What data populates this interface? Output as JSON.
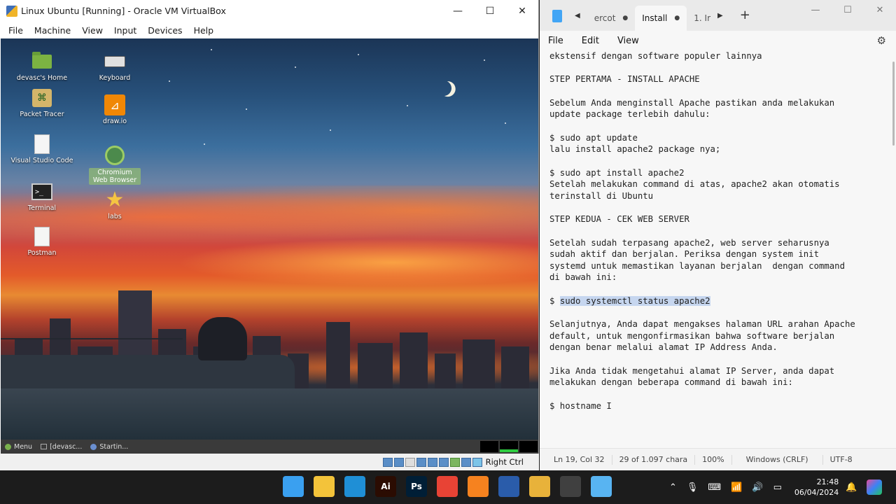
{
  "vbox": {
    "title": "Linux Ubuntu [Running] - Oracle VM VirtualBox",
    "window_controls": [
      "—",
      "☐",
      "✕"
    ],
    "menu": [
      "File",
      "Machine",
      "View",
      "Input",
      "Devices",
      "Help"
    ],
    "desktop_icons": [
      {
        "label": "devasc's Home",
        "icon": "folder-icon"
      },
      {
        "label": "Keyboard",
        "icon": "keyboard-icon"
      },
      {
        "label": "Packet Tracer",
        "icon": "packet-tracer-icon"
      },
      {
        "label": "draw.io",
        "icon": "drawio-icon"
      },
      {
        "label": "Visual Studio Code",
        "icon": "document-icon"
      },
      {
        "label": "Chromium Web Browser",
        "icon": "chromium-icon"
      },
      {
        "label": "Terminal",
        "icon": "terminal-icon"
      },
      {
        "label": "labs",
        "icon": "star-icon"
      },
      {
        "label": "Postman",
        "icon": "document-icon"
      }
    ],
    "guest_taskbar": {
      "menu": "Menu",
      "items": [
        "[devasc...",
        "Startin..."
      ]
    },
    "status": {
      "host_key": "Right Ctrl"
    }
  },
  "notepad": {
    "tabs": [
      "ercot",
      "Install",
      "1. Ir"
    ],
    "menu": [
      "File",
      "Edit",
      "View"
    ],
    "lines": [
      "ekstensif dengan software populer lainnya",
      "",
      "STEP PERTAMA - INSTALL APACHE",
      "",
      "Sebelum Anda menginstall Apache pastikan anda melakukan",
      "update package terlebih dahulu:",
      "",
      "$ sudo apt update",
      "lalu install apache2 package nya;",
      "",
      "$ sudo apt install apache2",
      "Setelah melakukan command di atas, apache2 akan otomatis",
      "terinstall di Ubuntu",
      "",
      "STEP KEDUA - CEK WEB SERVER",
      "",
      "Setelah sudah terpasang apache2, web server seharusnya",
      "sudah aktif dan berjalan. Periksa dengan system init",
      "systemd untuk memastikan layanan berjalan  dengan command",
      "di bawah ini:",
      "",
      "$ ",
      "",
      "Selanjutnya, Anda dapat mengakses halaman URL arahan Apache",
      "default, untuk mengonfirmasikan bahwa software berjalan",
      "dengan benar melalui alamat IP Address Anda.",
      "",
      "Jika Anda tidak mengetahui alamat IP Server, anda dapat",
      "melakukan dengan beberapa command di bawah ini:",
      "",
      "$ hostname I"
    ],
    "selected_text": "sudo systemctl status apache2",
    "status": {
      "position": "Ln 19, Col 32",
      "selection": "29 of 1.097 chara",
      "zoom": "100%",
      "line_ending": "Windows (CRLF)",
      "encoding": "UTF-8"
    }
  },
  "taskbar": {
    "apps": [
      {
        "name": "windows-start",
        "color": "#3aa0f0"
      },
      {
        "name": "file-explorer",
        "color": "#f3c33a"
      },
      {
        "name": "edge",
        "color": "#1f8fd6"
      },
      {
        "name": "illustrator",
        "color": "#2b0c02",
        "text": "Ai"
      },
      {
        "name": "photoshop",
        "color": "#001e36",
        "text": "Ps"
      },
      {
        "name": "chrome",
        "color": "#e84335"
      },
      {
        "name": "xampp",
        "color": "#f6821f"
      },
      {
        "name": "virtualbox",
        "color": "#2a5caa"
      },
      {
        "name": "paint",
        "color": "#e8b23a"
      },
      {
        "name": "obs",
        "color": "#404040"
      },
      {
        "name": "notepad",
        "color": "#58b4f2"
      }
    ],
    "clock": {
      "time": "21:48",
      "date": "06/04/2024"
    }
  }
}
